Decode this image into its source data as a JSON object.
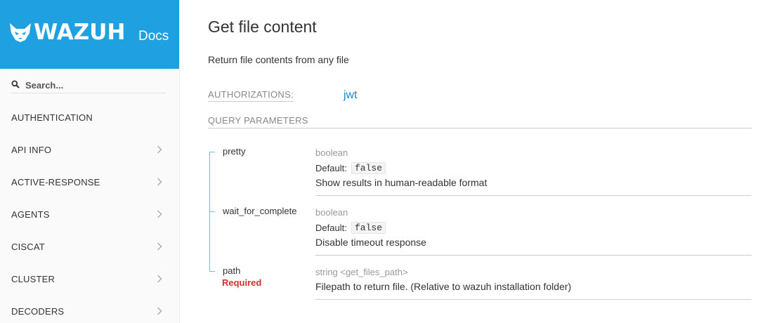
{
  "brand": {
    "logo_text": "WAZUH",
    "docs_label": "Docs",
    "color": "#1fa0e0"
  },
  "search": {
    "placeholder": "Search...",
    "value": ""
  },
  "sidebar": {
    "items": [
      {
        "label": "AUTHENTICATION",
        "has_chevron": false
      },
      {
        "label": "API INFO",
        "has_chevron": true
      },
      {
        "label": "ACTIVE-RESPONSE",
        "has_chevron": true
      },
      {
        "label": "AGENTS",
        "has_chevron": true
      },
      {
        "label": "CISCAT",
        "has_chevron": true
      },
      {
        "label": "CLUSTER",
        "has_chevron": true
      },
      {
        "label": "DECODERS",
        "has_chevron": true
      }
    ]
  },
  "operation": {
    "title": "Get file content",
    "description": "Return file contents from any file",
    "authorizations_label": "AUTHORIZATIONS:",
    "authorization_value": "jwt",
    "query_params_label": "QUERY PARAMETERS",
    "default_label": "Default:",
    "required_label": "Required",
    "link_color": "#1a86c8",
    "required_color": "#d03232",
    "params": [
      {
        "name": "pretty",
        "type": "boolean",
        "default": "false",
        "description": "Show results in human-readable format",
        "required": false
      },
      {
        "name": "wait_for_complete",
        "type": "boolean",
        "default": "false",
        "description": "Disable timeout response",
        "required": false
      },
      {
        "name": "path",
        "type": "string <get_files_path>",
        "default": null,
        "description": "Filepath to return file. (Relative to wazuh installation folder)",
        "required": true
      }
    ]
  },
  "icons": {
    "brand": "wolf-logo-icon",
    "search": "search-icon",
    "nav": "chevron-right-icon"
  }
}
